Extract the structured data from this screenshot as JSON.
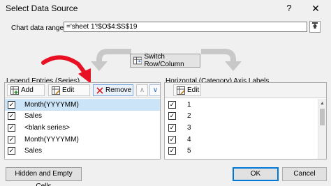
{
  "window": {
    "title": "Select Data Source",
    "help_label": "?",
    "close_label": "✕"
  },
  "range": {
    "label": "Chart data range:",
    "value": "='sheet 1'!$O$4:$S$19"
  },
  "switch_button": {
    "label": "Switch Row/Column"
  },
  "legend": {
    "heading": "Legend Entries (Series)",
    "add_label": "Add",
    "edit_label": "Edit",
    "remove_label": "Remove",
    "up_label": "∧",
    "down_label": "∨",
    "items": [
      {
        "label": "Month(YYYYMM)",
        "checked": true,
        "selected": true
      },
      {
        "label": "Sales",
        "checked": true,
        "selected": false
      },
      {
        "label": "<blank series>",
        "checked": true,
        "selected": false
      },
      {
        "label": "Month(YYYYMM)",
        "checked": true,
        "selected": false
      },
      {
        "label": "Sales",
        "checked": true,
        "selected": false
      }
    ]
  },
  "axis_labels": {
    "heading": "Horizontal (Category) Axis Labels",
    "edit_label": "Edit",
    "items": [
      {
        "label": "1",
        "checked": true
      },
      {
        "label": "2",
        "checked": true
      },
      {
        "label": "3",
        "checked": true
      },
      {
        "label": "4",
        "checked": true
      },
      {
        "label": "5",
        "checked": true
      }
    ]
  },
  "footer": {
    "hidden_cells_label": "Hidden and Empty Cells",
    "ok_label": "OK",
    "cancel_label": "Cancel"
  },
  "colors": {
    "accent": "#0078d7",
    "selection": "#cce4f7",
    "annotation_arrow": "#e81123"
  },
  "icons": [
    "add-icon",
    "edit-icon",
    "remove-icon",
    "switch-icon",
    "range-collapse-icon"
  ]
}
